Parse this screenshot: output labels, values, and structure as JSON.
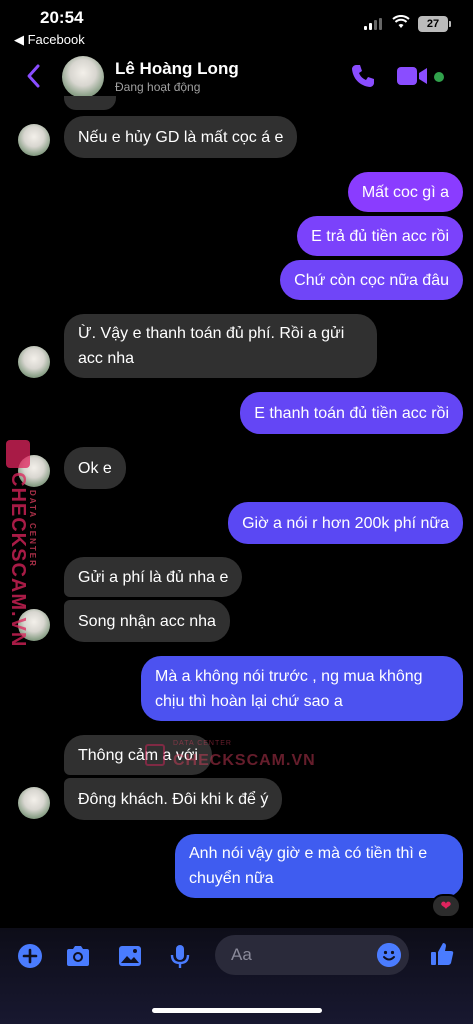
{
  "status_bar": {
    "time": "20:54",
    "back_app": "◀ Facebook",
    "battery": "27"
  },
  "header": {
    "contact_name": "Lê Hoàng Long",
    "contact_status": "Đang hoạt động"
  },
  "messages": [
    {
      "dir": "in",
      "text": "Nếu e hủy GD là mất cọc á e"
    },
    {
      "dir": "out",
      "text": "Mất coc gì a"
    },
    {
      "dir": "out",
      "text": "E trả đủ tiền acc rồi"
    },
    {
      "dir": "out",
      "text": "Chứ còn cọc nữa đâu"
    },
    {
      "dir": "in",
      "text": "Ừ. Vậy e thanh toán đủ phí. Rồi a gửi acc nha"
    },
    {
      "dir": "out",
      "text": "E thanh toán đủ tiền acc rồi"
    },
    {
      "dir": "in",
      "text": "Ok e"
    },
    {
      "dir": "out",
      "text": "Giờ a nói r hơn 200k phí nữa"
    },
    {
      "dir": "in",
      "text": "Gửi a phí là đủ nha e"
    },
    {
      "dir": "in",
      "text": "Song nhận acc nha"
    },
    {
      "dir": "out",
      "text": "Mà a không nói trước , ng mua không chịu thì hoàn lại chứ sao a"
    },
    {
      "dir": "in",
      "text": "Thông cảm a với"
    },
    {
      "dir": "in",
      "text": "Đông khách. Đôi khi k để ý"
    },
    {
      "dir": "out",
      "text": "Anh nói vậy giờ e mà có tiền thì e chuyển nữa"
    }
  ],
  "reaction": "❤",
  "watermark": {
    "brand": "CHECKSCAM.VN",
    "tagline": "DATA CENTER"
  },
  "composer": {
    "placeholder": "Aa"
  },
  "colors": {
    "accent": "#7b4dff",
    "bubble_out_top": "#8a3cff",
    "bubble_out_bottom": "#3f5cf0",
    "bubble_in": "#303030",
    "online": "#31a24c"
  },
  "icons": [
    "back-chevron-icon",
    "phone-icon",
    "video-camera-icon",
    "plus-circle-icon",
    "camera-icon",
    "image-icon",
    "microphone-icon",
    "emoji-icon",
    "thumbs-up-icon",
    "heart-icon"
  ]
}
